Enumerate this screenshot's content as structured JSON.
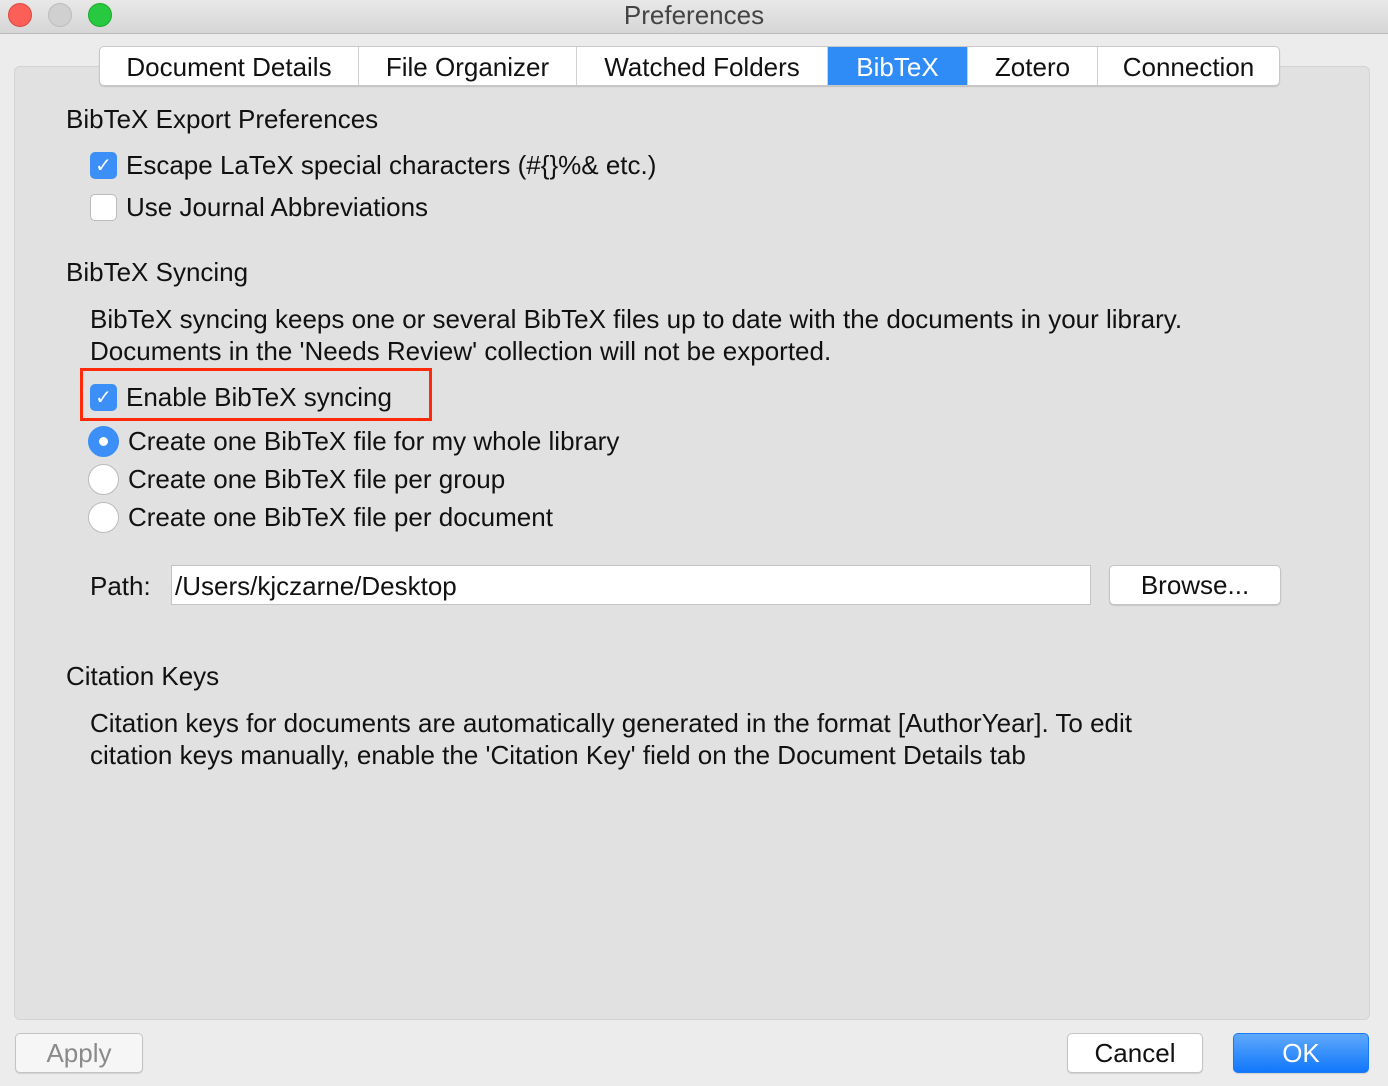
{
  "window": {
    "title": "Preferences"
  },
  "tabs": [
    {
      "label": "Document Details",
      "active": false
    },
    {
      "label": "File Organizer",
      "active": false
    },
    {
      "label": "Watched Folders",
      "active": false
    },
    {
      "label": "BibTeX",
      "active": true
    },
    {
      "label": "Zotero",
      "active": false
    },
    {
      "label": "Connection",
      "active": false
    }
  ],
  "export": {
    "heading": "BibTeX Export Preferences",
    "escape_latex": {
      "label": "Escape LaTeX special characters (#{}%& etc.)",
      "checked": true
    },
    "journal_abbrev": {
      "label": "Use Journal Abbreviations",
      "checked": false
    }
  },
  "syncing": {
    "heading": "BibTeX Syncing",
    "description_line1": "BibTeX syncing keeps one or several BibTeX files up to date with the documents in your library.",
    "description_line2": "Documents in the 'Needs Review' collection will not be exported.",
    "enable": {
      "label": "Enable BibTeX syncing",
      "checked": true
    },
    "options": [
      {
        "label": "Create one BibTeX file for my whole library",
        "selected": true
      },
      {
        "label": "Create one BibTeX file per group",
        "selected": false
      },
      {
        "label": "Create one BibTeX file per document",
        "selected": false
      }
    ],
    "path_label": "Path:",
    "path_value": "/Users/kjczarne/Desktop",
    "browse_label": "Browse..."
  },
  "citation": {
    "heading": "Citation Keys",
    "line1": "Citation keys for documents are automatically generated in the format [AuthorYear]. To edit",
    "line2": "citation keys manually, enable the 'Citation Key' field on the Document Details tab"
  },
  "footer": {
    "apply": "Apply",
    "cancel": "Cancel",
    "ok": "OK"
  },
  "colors": {
    "accent": "#2f8cf6",
    "highlight_box": "#ff2a0a"
  }
}
